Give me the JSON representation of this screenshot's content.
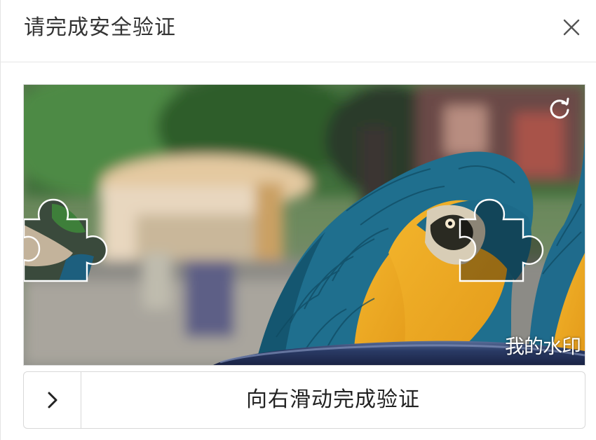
{
  "dialog": {
    "title": "请完成安全验证",
    "close_icon": "close-icon"
  },
  "puzzle": {
    "refresh_icon": "refresh-icon",
    "watermark": "我的水印"
  },
  "slider": {
    "handle_icon": "chevron-right-icon",
    "label": "向右滑动完成验证"
  }
}
